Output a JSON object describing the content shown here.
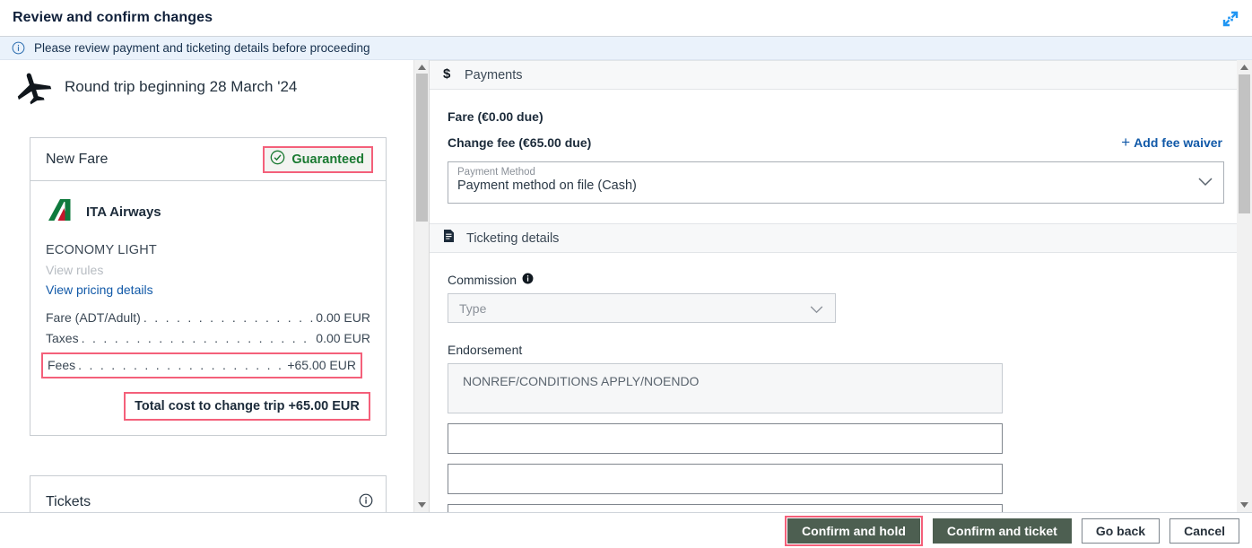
{
  "window": {
    "title": "Review and confirm changes",
    "collapse_icon": "collapse-diagonal-icon",
    "accent_highlight": "#f4607a",
    "primary_button_color": "#4d5f51",
    "link_color": "#1159a8"
  },
  "banner": {
    "icon": "info-circle-icon",
    "message": "Please review payment and ticketing details before proceeding",
    "background": "#eaf2fb"
  },
  "left": {
    "trip": {
      "icon": "airplane-icon",
      "title": "Round trip beginning 28 March '24"
    },
    "fare_card": {
      "heading": "New Fare",
      "badge": {
        "icon": "check-circle-icon",
        "label": "Guaranteed",
        "color": "#1b7a32"
      },
      "airline": {
        "logo": "ita-airways-logo-icon",
        "name": "ITA Airways"
      },
      "cabin": "ECONOMY LIGHT",
      "view_rules_label": "View rules",
      "view_pricing_label": "View pricing details",
      "price_lines": [
        {
          "label": "Fare (ADT/Adult)",
          "value": "0.00 EUR",
          "highlighted": false
        },
        {
          "label": "Taxes",
          "value": "0.00 EUR",
          "highlighted": false
        },
        {
          "label": "Fees",
          "value": "+65.00 EUR",
          "highlighted": true
        }
      ],
      "total": "Total cost to change trip +65.00 EUR"
    },
    "tickets_card": {
      "heading": "Tickets",
      "icon": "info-circle-icon"
    },
    "scrollbar": {
      "up_arrow": "scroll-up-arrow-icon",
      "down_arrow": "scroll-down-arrow-icon"
    }
  },
  "right": {
    "payments": {
      "icon": "dollar-sign-icon",
      "heading": "Payments",
      "fare_line": "Fare (€0.00 due)",
      "change_fee_line": "Change fee (€65.00 due)",
      "add_waiver_label": "Add fee waiver",
      "add_waiver_plus": "+",
      "payment_method": {
        "label": "Payment Method",
        "value": "Payment method on file (Cash)",
        "chevron": "chevron-down-icon"
      }
    },
    "ticketing": {
      "icon": "document-icon",
      "heading": "Ticketing details",
      "commission": {
        "label": "Commission",
        "info_icon": "info-filled-icon",
        "placeholder": "Type",
        "chevron": "chevron-down-icon"
      },
      "endorsement": {
        "label": "Endorsement",
        "value": "NONREF/CONDITIONS APPLY/NOENDO"
      },
      "extra_fields": [
        {
          "value": ""
        },
        {
          "value": ""
        }
      ]
    },
    "scrollbar": {
      "up_arrow": "scroll-up-arrow-icon",
      "down_arrow": "scroll-down-arrow-icon"
    }
  },
  "footer": {
    "buttons": [
      {
        "label": "Confirm and hold",
        "style": "primary",
        "highlighted": true
      },
      {
        "label": "Confirm and ticket",
        "style": "primary",
        "highlighted": false
      },
      {
        "label": "Go back",
        "style": "secondary",
        "highlighted": false
      },
      {
        "label": "Cancel",
        "style": "secondary",
        "highlighted": false
      }
    ]
  }
}
